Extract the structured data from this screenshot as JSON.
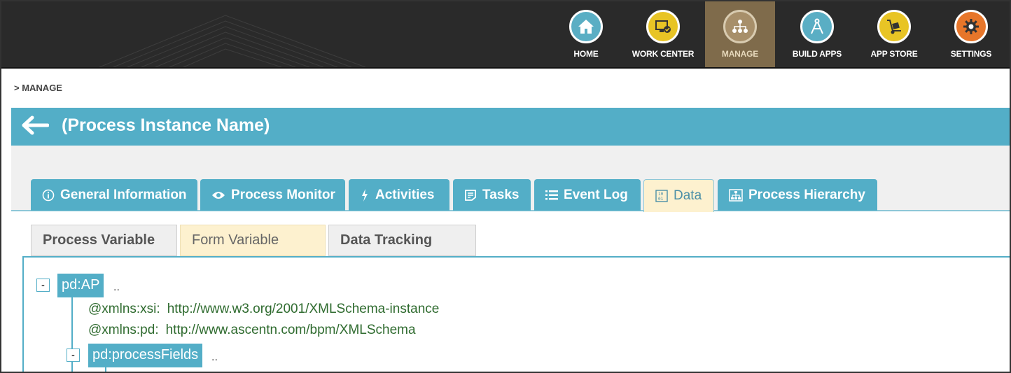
{
  "nav": {
    "items": [
      {
        "label": "HOME",
        "icon": "home-icon"
      },
      {
        "label": "WORK CENTER",
        "icon": "work-center-icon"
      },
      {
        "label": "MANAGE",
        "icon": "manage-icon",
        "active": true
      },
      {
        "label": "BUILD APPS",
        "icon": "compass-icon"
      },
      {
        "label": "APP STORE",
        "icon": "hand-truck-icon"
      },
      {
        "label": "SETTINGS",
        "icon": "gear-icon"
      }
    ],
    "active_color": "#7f6b4b"
  },
  "breadcrumb": "> MANAGE",
  "title": "(Process Instance Name)",
  "main_tabs": [
    {
      "label": "General Information",
      "icon": "info-icon"
    },
    {
      "label": "Process Monitor",
      "icon": "eye-icon"
    },
    {
      "label": "Activities",
      "icon": "lightning-icon"
    },
    {
      "label": "Tasks",
      "icon": "tasks-icon"
    },
    {
      "label": "Event Log",
      "icon": "list-icon"
    },
    {
      "label": "Data",
      "icon": "data-icon",
      "active": true
    },
    {
      "label": "Process Hierarchy",
      "icon": "hierarchy-icon"
    }
  ],
  "sub_tabs": [
    {
      "label": "Process Variable"
    },
    {
      "label": "Form Variable",
      "active": true
    },
    {
      "label": "Data Tracking"
    }
  ],
  "tree": {
    "root": {
      "label": "pd:AP",
      "toggle": "-",
      "ellipsis": ".."
    },
    "attributes": [
      {
        "key": "@xmlns:xsi:",
        "value": "http://www.w3.org/2001/XMLSchema-instance"
      },
      {
        "key": "@xmlns:pd:",
        "value": "http://www.ascentn.com/bpm/XMLSchema"
      }
    ],
    "child": {
      "label": "pd:processFields",
      "toggle": "-",
      "ellipsis": ".."
    }
  },
  "colors": {
    "accent": "#53aec7",
    "topbar": "#2a2a2a",
    "active_tab": "#fdf1cf",
    "attr_text": "#2f6b2f"
  }
}
